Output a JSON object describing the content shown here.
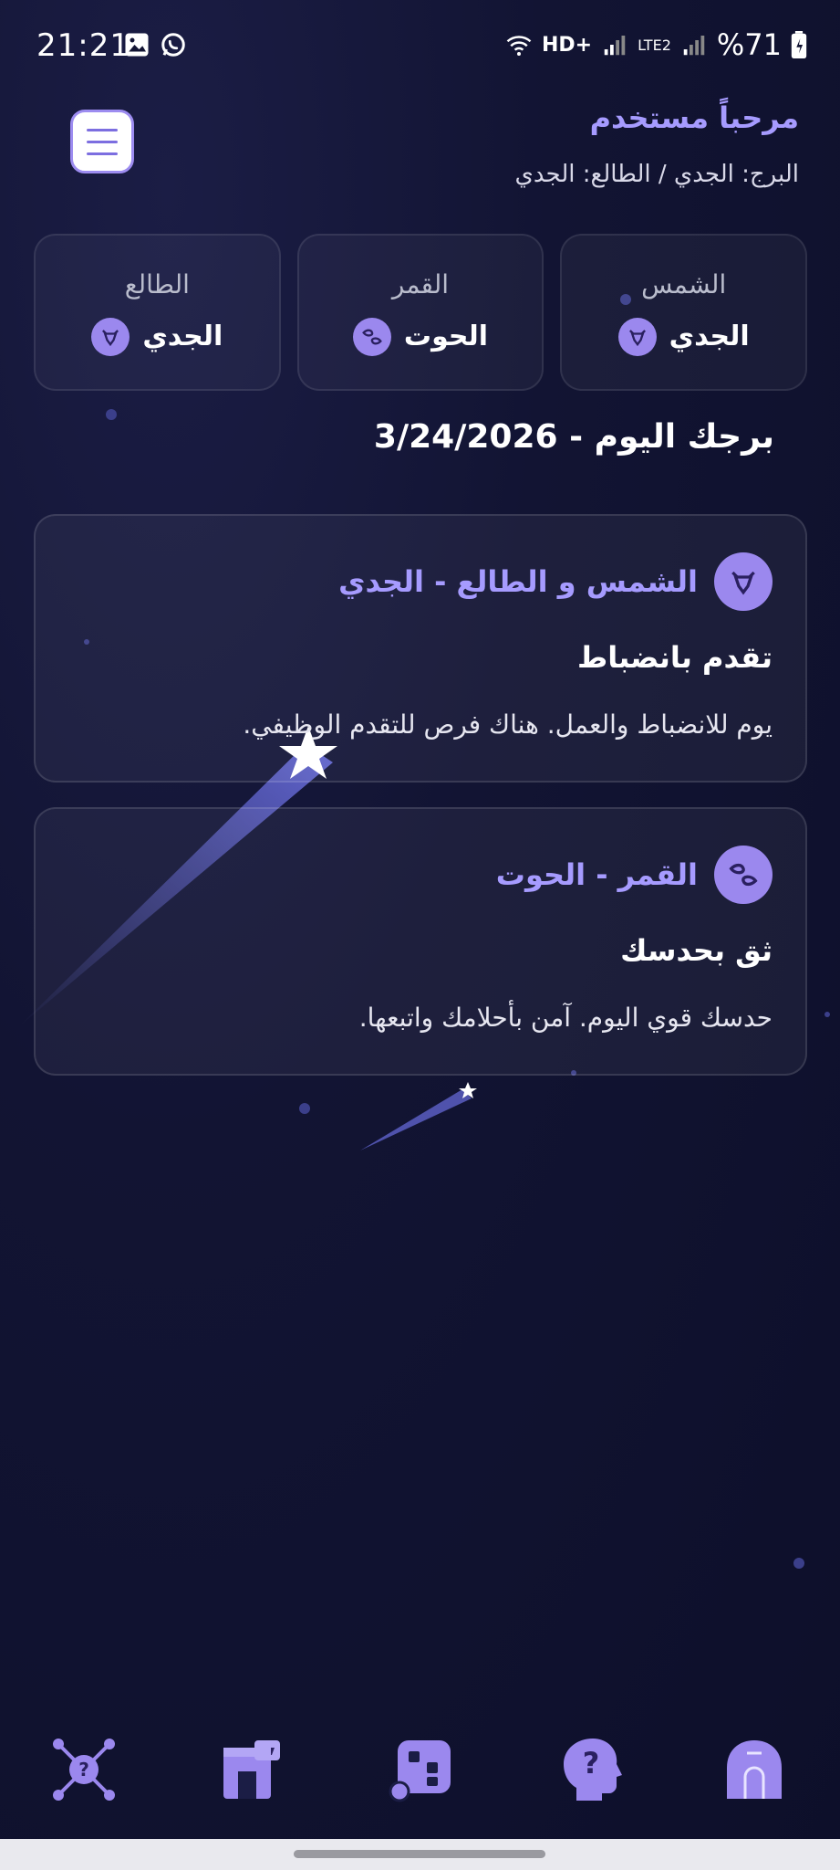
{
  "status_bar": {
    "time": "21:21",
    "network": "HD+",
    "lte": "LTE2",
    "battery": "%71"
  },
  "header": {
    "welcome": "مرحباً مستخدم",
    "subtitle": "البرج: الجدي / الطالع: الجدي"
  },
  "signs": [
    {
      "label": "الشمس",
      "value": "الجدي",
      "icon": "capricorn-icon"
    },
    {
      "label": "القمر",
      "value": "الحوت",
      "icon": "pisces-icon"
    },
    {
      "label": "الطالع",
      "value": "الجدي",
      "icon": "capricorn-icon"
    }
  ],
  "today_title": "برجك اليوم - 3/24/2026",
  "horoscopes": [
    {
      "title": "الشمس و الطالع - الجدي",
      "heading": "تقدم بانضباط",
      "text": "يوم للانضباط والعمل. هناك فرص للتقدم الوظيفي.",
      "icon": "capricorn-icon"
    },
    {
      "title": "القمر - الحوت",
      "heading": "ثق بحدسك",
      "text": "حدسك قوي اليوم. آمن بأحلامك واتبعها.",
      "icon": "pisces-icon"
    }
  ],
  "nav": [
    "network-question-icon",
    "store-icon",
    "apps-icon",
    "head-question-icon",
    "home-icon"
  ],
  "colors": {
    "accent": "#a69bff",
    "icon_bg": "#9b88ee",
    "background": "#121433"
  }
}
